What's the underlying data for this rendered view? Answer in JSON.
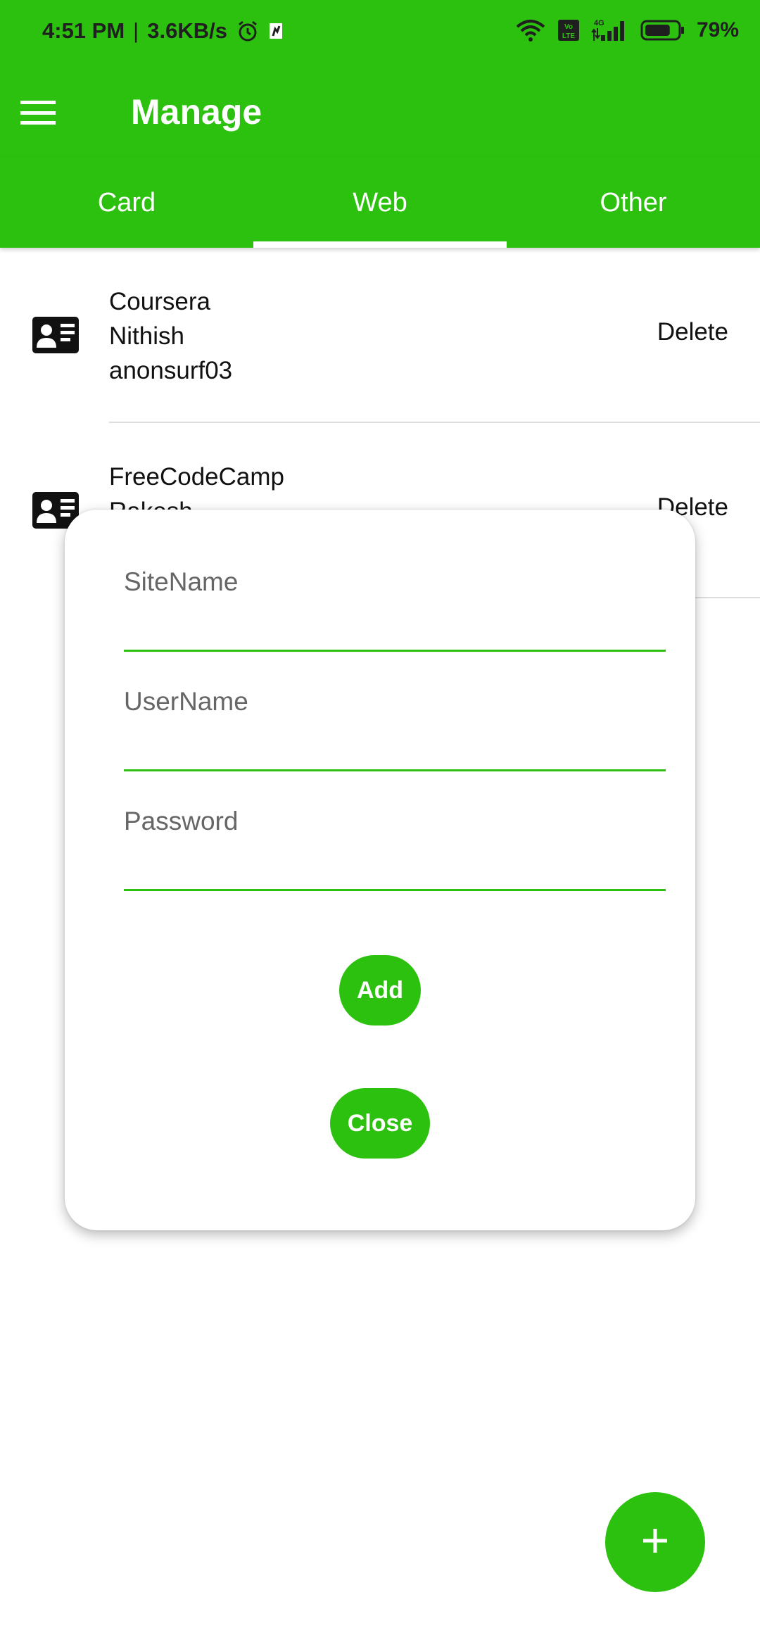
{
  "status_bar": {
    "time": "4:51 PM",
    "separator": "|",
    "network_speed": "3.6KB/s",
    "volte": "Vo\nLTE",
    "network_type": "4G",
    "battery_percent": "79%",
    "battery_level": 0.79
  },
  "app_bar": {
    "title": "Manage"
  },
  "tabs": [
    {
      "label": "Card",
      "selected": false
    },
    {
      "label": "Web",
      "selected": true
    },
    {
      "label": "Other",
      "selected": false
    }
  ],
  "list": {
    "items": [
      {
        "line1": "Coursera",
        "line2": "Nithish",
        "line3": "anonsurf03",
        "action": "Delete"
      },
      {
        "line1": "FreeCodeCamp",
        "line2": "Rakesh",
        "line3": "",
        "action": "Delete"
      }
    ]
  },
  "dialog": {
    "site_label": "SiteName",
    "site_value": "",
    "user_label": "UserName",
    "user_value": "",
    "password_label": "Password",
    "password_value": "",
    "add_label": "Add",
    "close_label": "Close"
  },
  "fab": {
    "label": "+"
  },
  "colors": {
    "primary": "#2dc10f",
    "on_primary": "#ffffff",
    "text": "#111111",
    "hint": "#666666"
  }
}
